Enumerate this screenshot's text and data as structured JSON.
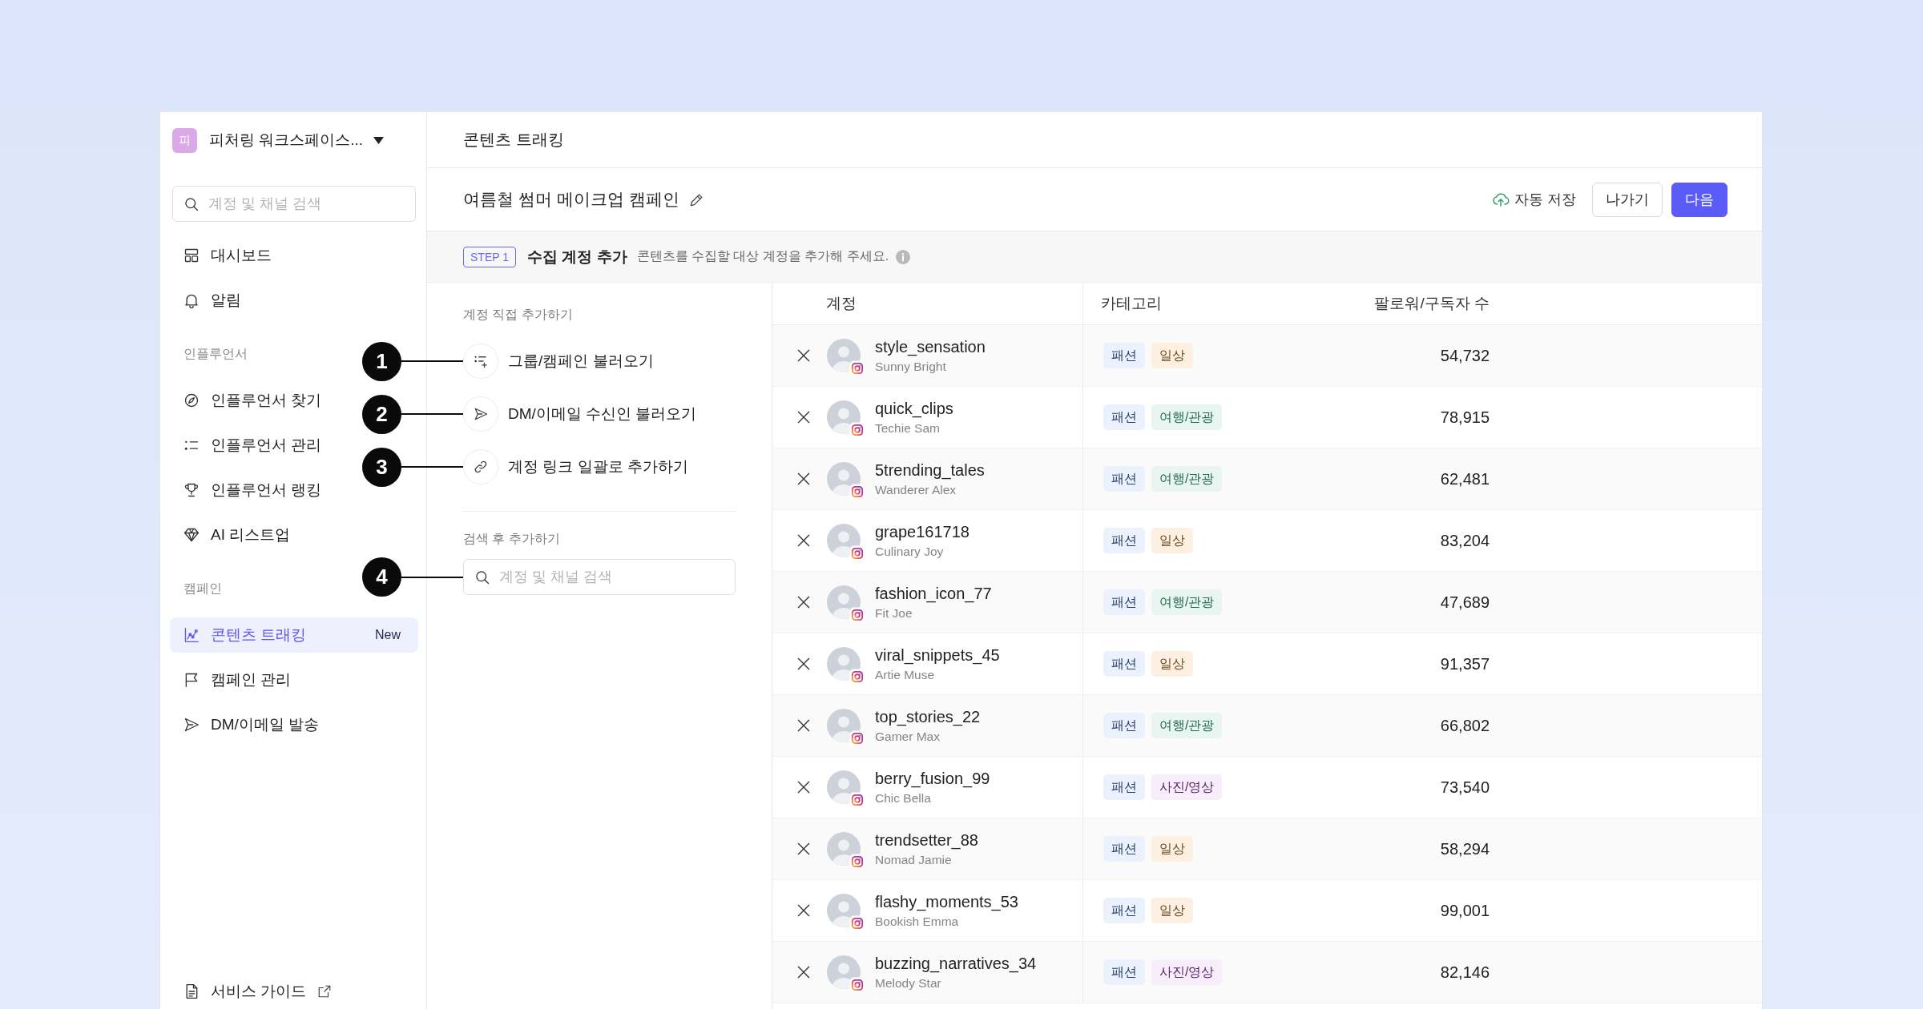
{
  "sidebar": {
    "workspace": {
      "initial": "피",
      "name": "피처링 워크스페이스..."
    },
    "search": {
      "placeholder": "계정 및 채널 검색"
    },
    "sections": [
      {
        "items": [
          {
            "label": "대시보드",
            "selected": false
          },
          {
            "label": "알림",
            "selected": false
          }
        ]
      },
      {
        "title": "인플루언서",
        "items": [
          {
            "label": "인플루언서 찾기",
            "selected": false
          },
          {
            "label": "인플루언서 관리",
            "selected": false
          },
          {
            "label": "인플루언서 랭킹",
            "selected": false
          },
          {
            "label": "AI 리스트업",
            "selected": false
          }
        ]
      },
      {
        "title": "캠페인",
        "items": [
          {
            "label": "콘텐츠 트래킹",
            "selected": true,
            "badge": "New"
          },
          {
            "label": "캠페인 관리",
            "selected": false
          },
          {
            "label": "DM/이메일 발송",
            "selected": false
          }
        ]
      }
    ],
    "footer": {
      "label": "서비스 가이드"
    }
  },
  "header": {
    "title": "콘텐츠 트래킹"
  },
  "campaign": {
    "title": "여름철 썸머 메이크업 캠페인",
    "autosave": "자동 저장",
    "buttons": [
      {
        "label": "나가기",
        "kind": "secondary"
      },
      {
        "label": "다음",
        "kind": "primary"
      }
    ]
  },
  "step": {
    "badge": "STEP 1",
    "title": "수집 계정 추가",
    "description": "콘텐츠를 수집할 대상 계정을 추가해 주세요."
  },
  "add_panel": {
    "direct_title": "계정 직접 추가하기",
    "options": [
      {
        "label": "그룹/캠페인 불러오기",
        "callout": "1"
      },
      {
        "label": "DM/이메일 수신인 불러오기",
        "callout": "2"
      },
      {
        "label": "계정 링크 일괄로 추가하기",
        "callout": "3"
      }
    ],
    "search_title": "검색 후 추가하기",
    "search": {
      "placeholder": "계정 및 채널 검색",
      "callout": "4"
    }
  },
  "table": {
    "columns": [
      "계정",
      "카테고리",
      "팔로워/구독자 수"
    ],
    "rows": [
      {
        "handle": "style_sensation",
        "name": "Sunny Bright",
        "tags": [
          {
            "label": "패션",
            "color": "#ecf2fd"
          },
          {
            "label": "일상",
            "color": "#fdf0e0"
          }
        ],
        "followers": "54,732"
      },
      {
        "handle": "quick_clips",
        "name": "Techie Sam",
        "tags": [
          {
            "label": "패션",
            "color": "#ecf2fd"
          },
          {
            "label": "여행/관광",
            "color": "#e8f5f0"
          }
        ],
        "followers": "78,915"
      },
      {
        "handle": "5trending_tales",
        "name": "Wanderer Alex",
        "tags": [
          {
            "label": "패션",
            "color": "#ecf2fd"
          },
          {
            "label": "여행/관광",
            "color": "#e8f5f0"
          }
        ],
        "followers": "62,481"
      },
      {
        "handle": "grape161718",
        "name": "Culinary Joy",
        "tags": [
          {
            "label": "패션",
            "color": "#ecf2fd"
          },
          {
            "label": "일상",
            "color": "#fdf0e0"
          }
        ],
        "followers": "83,204"
      },
      {
        "handle": "fashion_icon_77",
        "name": "Fit Joe",
        "tags": [
          {
            "label": "패션",
            "color": "#ecf2fd"
          },
          {
            "label": "여행/관광",
            "color": "#e8f5f0"
          }
        ],
        "followers": "47,689"
      },
      {
        "handle": "viral_snippets_45",
        "name": "Artie Muse",
        "tags": [
          {
            "label": "패션",
            "color": "#ecf2fd"
          },
          {
            "label": "일상",
            "color": "#fdf0e0"
          }
        ],
        "followers": "91,357"
      },
      {
        "handle": "top_stories_22",
        "name": "Gamer Max",
        "tags": [
          {
            "label": "패션",
            "color": "#ecf2fd"
          },
          {
            "label": "여행/관광",
            "color": "#e8f5f0"
          }
        ],
        "followers": "66,802"
      },
      {
        "handle": "berry_fusion_99",
        "name": "Chic Bella",
        "tags": [
          {
            "label": "패션",
            "color": "#ecf2fd"
          },
          {
            "label": "사진/영상",
            "color": "#f8edfb"
          }
        ],
        "followers": "73,540"
      },
      {
        "handle": "trendsetter_88",
        "name": "Nomad Jamie",
        "tags": [
          {
            "label": "패션",
            "color": "#ecf2fd"
          },
          {
            "label": "일상",
            "color": "#fdf0e0"
          }
        ],
        "followers": "58,294"
      },
      {
        "handle": "flashy_moments_53",
        "name": "Bookish Emma",
        "tags": [
          {
            "label": "패션",
            "color": "#ecf2fd"
          },
          {
            "label": "일상",
            "color": "#fdf0e0"
          }
        ],
        "followers": "99,001"
      },
      {
        "handle": "buzzing_narratives_34",
        "name": "Melody Star",
        "tags": [
          {
            "label": "패션",
            "color": "#ecf2fd"
          },
          {
            "label": "사진/영상",
            "color": "#f8edfb"
          }
        ],
        "followers": "82,146"
      }
    ]
  }
}
